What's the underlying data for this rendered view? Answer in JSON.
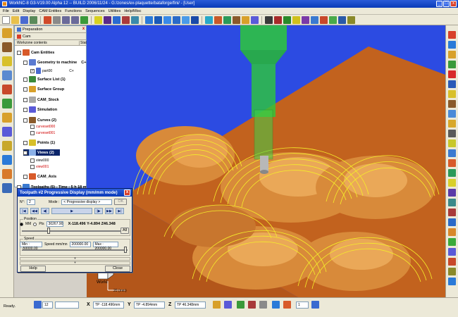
{
  "window": {
    "title": "WorkNC-8 G3-V19.00 Alpha 12 -- BUILD 2006/11/24 - G:/zones/ex-plaquette/bataforge/fini/ - [User]",
    "buttons": [
      "_",
      "□",
      "x"
    ]
  },
  "menu": [
    "File",
    "Edit",
    "Display",
    "CAM Entities",
    "Functions",
    "Sequences",
    "Utilities",
    "Help/Misc"
  ],
  "panel": {
    "tab_label": "Preparation",
    "sub_tab": "Cam",
    "header_left": "Workzone contents",
    "header_right": "Stat",
    "tree": [
      {
        "label": "Cam Entities",
        "bold": true
      },
      {
        "label": "Geometry to machine",
        "bold": true,
        "suffix": "C+"
      },
      {
        "label": "part00",
        "bold": false,
        "suffix": "C+"
      },
      {
        "label": "Surface List (1)",
        "bold": true
      },
      {
        "label": "Surface Group",
        "bold": true
      },
      {
        "label": "CAM_Stock",
        "bold": true
      },
      {
        "label": "Simulation",
        "bold": true
      },
      {
        "label": "Curves (2)",
        "bold": true
      },
      {
        "label": "curveset000",
        "bold": false,
        "red": true
      },
      {
        "label": "curveset001",
        "bold": false,
        "red": true
      },
      {
        "label": "Points (1)",
        "bold": true
      },
      {
        "label": "Views (2)",
        "bold": true,
        "selected": true
      },
      {
        "label": "view000",
        "bold": false
      },
      {
        "label": "view001",
        "bold": false,
        "red": true
      },
      {
        "label": "CAM_Axis",
        "bold": true
      },
      {
        "label": "Toolpaths (5) - Time : 5 h 18 m",
        "bold": true
      }
    ]
  },
  "dialog": {
    "title": "Toolpath #2 Progressive Display (mm/mm mode)",
    "n_label": "N°:",
    "n_value": "2",
    "mode_label": "Mode :",
    "mode_value": "< Progressive display >",
    "ok_label": "OK",
    "position_label": "Position",
    "mm_label": "MM",
    "pts_label": "Pts",
    "pts_value": "30267.90",
    "coords": "X-118.496 Y-4.894 Z46.348",
    "all_label": "All",
    "speed_label": "Speed",
    "min_label": "Min : -50000.00",
    "speed_mm_label": "Speed mm/mn",
    "speed_value": "200000.00",
    "max_label": "Max : 200000.00",
    "help_label": "Help",
    "close_label": "Close"
  },
  "viewport": {
    "world_label": "World",
    "scale_label": "20 (mm)"
  },
  "status": {
    "ready": "Ready.",
    "field1": "12",
    "x_label": "X",
    "x_value": "TP -118.496mm",
    "y_label": "Y",
    "y_value": "TP -4.894mm",
    "z_label": "Z",
    "z_value": "TP 46.348mm",
    "page_value": "1"
  },
  "colors": {
    "viewport_bg": "#2c4be2",
    "part_face": "#c2621e",
    "toolpath": "#f5ee2a",
    "tool": "#2ec83a",
    "titlebar": "#0a3ab8"
  }
}
